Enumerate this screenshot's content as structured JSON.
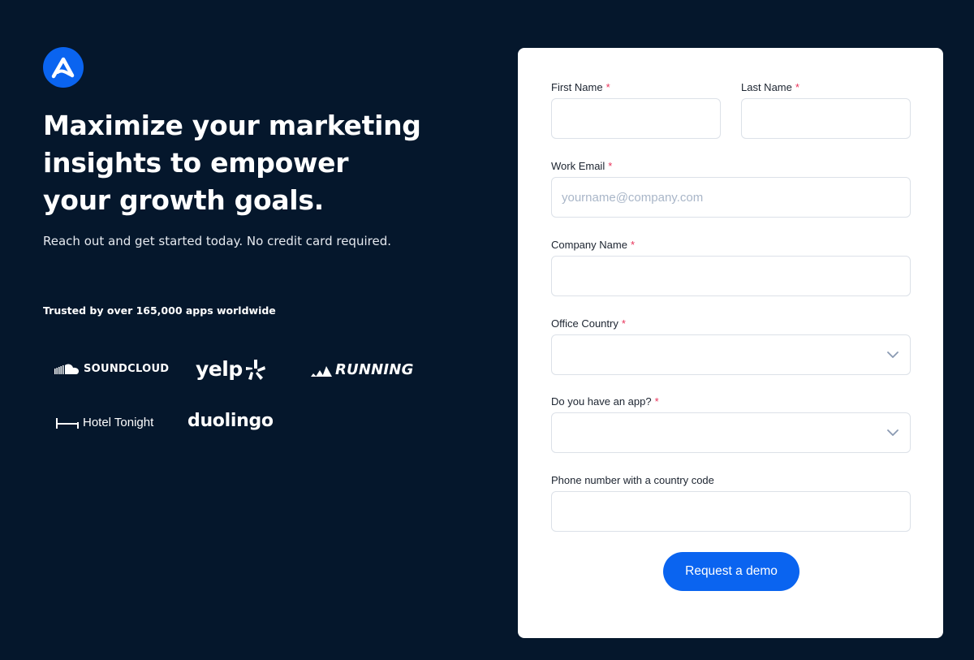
{
  "brand": {
    "accent": "#0A64F0",
    "background": "#05172C"
  },
  "hero": {
    "headline": "Maximize your marketing insights to empower your growth goals.",
    "subline": "Reach out and get started today. No credit card required.",
    "trusted": "Trusted by over 165,000 apps worldwide"
  },
  "logos": {
    "soundcloud": "SOUNDCLOUD",
    "yelp": "yelp",
    "running": "RUNNING",
    "hoteltonight": "Hotel Tonight",
    "duolingo": "duolingo"
  },
  "form": {
    "first_name": {
      "label": "First Name",
      "required": "*",
      "value": ""
    },
    "last_name": {
      "label": "Last Name",
      "required": "*",
      "value": ""
    },
    "work_email": {
      "label": "Work Email",
      "required": "*",
      "placeholder": "yourname@company.com",
      "value": ""
    },
    "company_name": {
      "label": "Company Name",
      "required": "*",
      "value": ""
    },
    "office_country": {
      "label": "Office Country",
      "required": "*",
      "selected": ""
    },
    "has_app": {
      "label": "Do you have an app?",
      "required": "*",
      "selected": ""
    },
    "phone": {
      "label": "Phone number with a country code",
      "value": ""
    },
    "submit_label": "Request a demo"
  }
}
